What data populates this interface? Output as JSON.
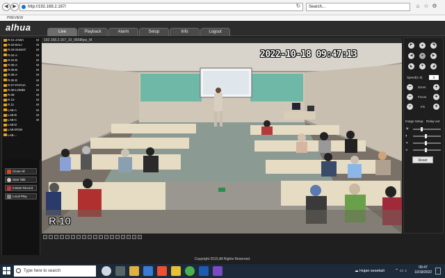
{
  "browser": {
    "address": "http://192.168.2.167/",
    "search_placeholder": "Search...",
    "tab_title": "PREVIEW"
  },
  "app": {
    "logo": "alhua",
    "tabs": [
      "Live",
      "Playback",
      "Alarm",
      "Setup",
      "Info",
      "Logout"
    ],
    "active_tab": "Live",
    "channels": [
      {
        "name": "R.01-JAWA",
        "mark": "M"
      },
      {
        "name": "R.02-BALI",
        "mark": "M"
      },
      {
        "name": "R.03-SUMAT",
        "mark": "M"
      },
      {
        "name": "R.04-A",
        "mark": "M"
      },
      {
        "name": "R.04-B",
        "mark": "M"
      },
      {
        "name": "R.05-A",
        "mark": "M"
      },
      {
        "name": "R.05-B",
        "mark": "M"
      },
      {
        "name": "R.06-A",
        "mark": "M"
      },
      {
        "name": "R.06 B",
        "mark": "M"
      },
      {
        "name": "R.07-PAPUA",
        "mark": "M"
      },
      {
        "name": "R.08-LOMBI",
        "mark": "M"
      },
      {
        "name": "R.09",
        "mark": "M"
      },
      {
        "name": "R.10",
        "mark": "M"
      },
      {
        "name": "R.11",
        "mark": "M"
      },
      {
        "name": "LAB-A",
        "mark": "M"
      },
      {
        "name": "LAB-B",
        "mark": "M"
      },
      {
        "name": "LAB-C",
        "mark": "M"
      },
      {
        "name": "LAB-D",
        "mark": ""
      },
      {
        "name": "LAB-IRGN",
        "mark": ""
      },
      {
        "name": "LAB-...",
        "mark": ""
      }
    ],
    "buttons": {
      "close_all": "Close All",
      "start_talk": "Start Talk",
      "instant_record": "Instant Record",
      "local_play": "Local Play"
    },
    "video": {
      "title": "192.168.2.167_10_9668bps_M",
      "timestamp": "2022-10-18 09:47:13",
      "camera_name": "R.10"
    },
    "ptz": {
      "speed_label": "Speed(1-8)",
      "speed_value": "5",
      "zoom_label": "Zoom",
      "focus_label": "Focus",
      "iris_label": "Iris"
    },
    "image_setup": {
      "label": "Image Setup",
      "relay_label": "Relay-out",
      "reset_label": "Reset",
      "levels": [
        0.3,
        0.45,
        0.45,
        0.45
      ]
    },
    "footer": "Copyright 2015,All Rights Reserved."
  },
  "taskbar": {
    "search_placeholder": "Type here to search",
    "weather": "Hujan sesekali",
    "time": "09:47",
    "date": "10/18/2022"
  },
  "colors": {
    "accent": "#e8a020",
    "close_all": "#d04a20",
    "taskbar": "#1c2a3a"
  }
}
